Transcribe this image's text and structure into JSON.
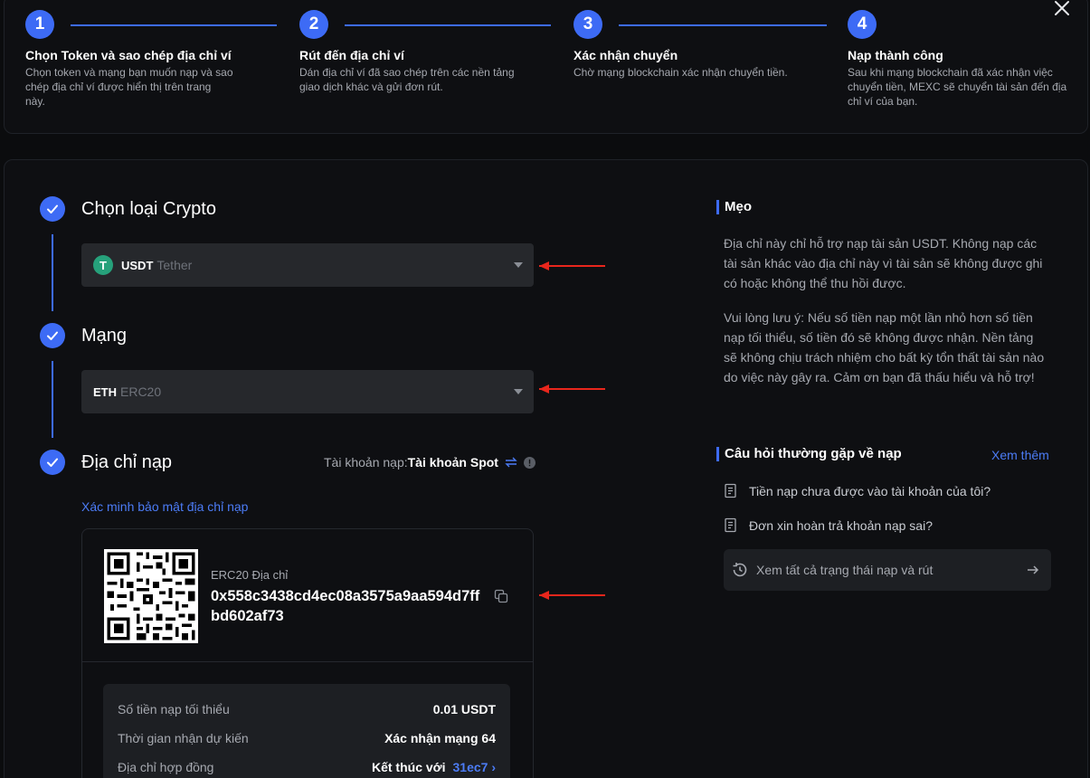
{
  "steps": [
    {
      "num": "1",
      "title": "Chọn Token và sao chép địa chỉ ví",
      "desc": "Chọn token và mạng bạn muốn nạp và sao chép địa chỉ ví được hiển thị trên trang này."
    },
    {
      "num": "2",
      "title": "Rút đến địa chỉ ví",
      "desc": "Dán địa chỉ ví đã sao chép trên các nền tảng giao dịch khác và gửi đơn rút."
    },
    {
      "num": "3",
      "title": "Xác nhận chuyển",
      "desc": "Chờ mạng blockchain xác nhận chuyển tiền."
    },
    {
      "num": "4",
      "title": "Nạp thành công",
      "desc": "Sau khi mạng blockchain đã xác nhận việc chuyển tiền, MEXC sẽ chuyển tài sản đến địa chỉ ví của bạn."
    }
  ],
  "sections": {
    "crypto_title": "Chọn loại Crypto",
    "network_title": "Mạng",
    "address_title": "Địa chỉ nạp"
  },
  "crypto_select": {
    "symbol": "USDT",
    "name": "Tether",
    "icon_letter": "T"
  },
  "network_select": {
    "symbol": "ETH",
    "name": "ERC20"
  },
  "account": {
    "label": "Tài khoản nạp:",
    "value": "Tài khoản Spot"
  },
  "verify_link": "Xác minh bảo mật địa chỉ nạp",
  "address": {
    "label": "ERC20 Địa chỉ",
    "value": "0x558c3438cd4ec08a3575a9aa594d7ffbd602af73"
  },
  "info_rows": [
    {
      "key": "Số tiền nạp tối thiểu",
      "value": "0.01 USDT"
    },
    {
      "key": "Thời gian nhận dự kiến",
      "value": "Xác nhận mạng 64"
    },
    {
      "key": "Địa chỉ hợp đồng",
      "value": "Kết thúc với",
      "extra": "31ec7 ›"
    }
  ],
  "tips": {
    "title": "Mẹo",
    "p1": "Địa chỉ này chỉ hỗ trợ nạp tài sản USDT. Không nạp các tài sản khác vào địa chỉ này vì tài sản sẽ không được ghi có hoặc không thể thu hồi được.",
    "p2": "Vui lòng lưu ý: Nếu số tiền nạp một lần nhỏ hơn số tiền nạp tối thiểu, số tiền đó sẽ không được nhận. Nền tảng sẽ không chịu trách nhiệm cho bất kỳ tổn thất tài sản nào do việc này gây ra. Cảm ơn bạn đã thấu hiểu và hỗ trợ!"
  },
  "faq": {
    "title": "Câu hỏi thường gặp về nạp",
    "more": "Xem thêm",
    "items": [
      "Tiền nạp chưa được vào tài khoản của tôi?",
      "Đơn xin hoàn trả khoản nạp sai?"
    ],
    "status_button": "Xem tất cả trạng thái nạp và rút"
  },
  "colors": {
    "accent": "#3d6bf5",
    "link": "#4c7cf6",
    "arrow": "#e8261c",
    "tether": "#26a17b"
  },
  "icons": [
    "close-icon",
    "check-icon",
    "chevron-down-icon",
    "copy-icon",
    "swap-icon",
    "info-icon",
    "document-icon",
    "history-icon",
    "arrow-right-icon",
    "qr-code"
  ]
}
